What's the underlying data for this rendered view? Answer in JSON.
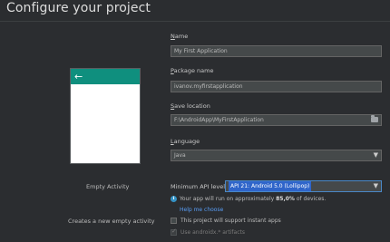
{
  "header": {
    "title": "Configure your project"
  },
  "template": {
    "name": "Empty Activity",
    "description": "Creates a new empty activity",
    "accent_color": "#0f8f7e",
    "back_icon": "←"
  },
  "form": {
    "name": {
      "label_first": "N",
      "label_rest": "ame",
      "value": "My First Application"
    },
    "package": {
      "label_first": "P",
      "label_rest": "ackage name",
      "value": "ivanov.myfirstapplication"
    },
    "save": {
      "label_first": "S",
      "label_rest": "ave location",
      "value": "F:\\AndroidApp\\MyFirstApplication",
      "icon": "folder-icon"
    },
    "language": {
      "label_first": "L",
      "label_rest": "anguage",
      "value": "Java"
    },
    "min_api": {
      "label": "Minimum API level",
      "value": "API 21: Android 5.0 (Lollipop)"
    },
    "info": {
      "text_before": "Your app will run on approximately ",
      "percent": "85,0%",
      "text_after": " of devices."
    },
    "help_link": "Help me choose",
    "instant_apps": {
      "label": "This project will support instant apps",
      "checked": false
    },
    "androidx": {
      "label": "Use androidx.* artifacts",
      "checked": true,
      "enabled": false
    }
  }
}
